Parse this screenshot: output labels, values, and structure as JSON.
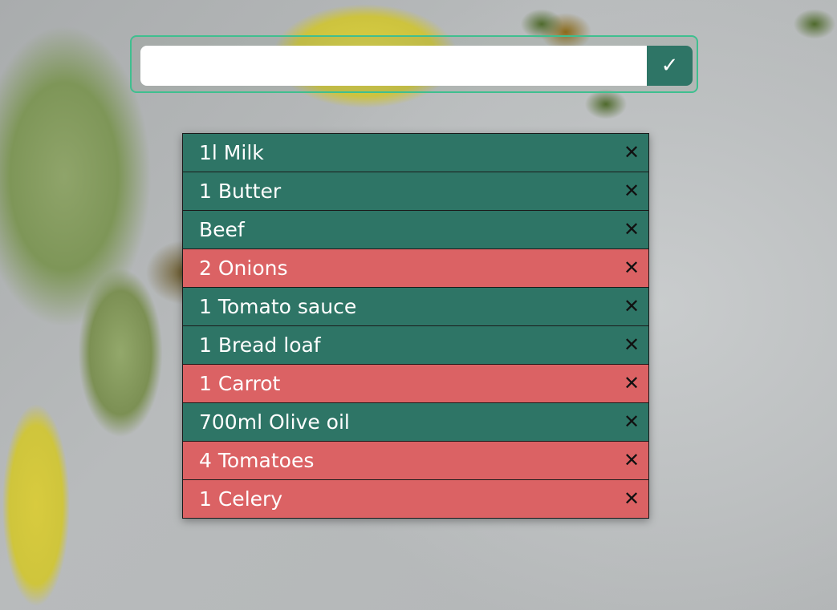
{
  "form": {
    "input_value": "",
    "input_placeholder": "",
    "submit_icon": "✓"
  },
  "colors": {
    "green": "#2e7566",
    "red": "#db6264",
    "accent_border": "#3fbf8f"
  },
  "items": [
    {
      "label": "1l Milk",
      "status": "green",
      "remove_icon": "✕"
    },
    {
      "label": "1 Butter",
      "status": "green",
      "remove_icon": "✕"
    },
    {
      "label": "Beef",
      "status": "green",
      "remove_icon": "✕"
    },
    {
      "label": "2 Onions",
      "status": "red",
      "remove_icon": "✕"
    },
    {
      "label": "1 Tomato sauce",
      "status": "green",
      "remove_icon": "✕"
    },
    {
      "label": "1 Bread loaf",
      "status": "green",
      "remove_icon": "✕"
    },
    {
      "label": "1 Carrot",
      "status": "red",
      "remove_icon": "✕"
    },
    {
      "label": "700ml Olive oil",
      "status": "green",
      "remove_icon": "✕"
    },
    {
      "label": "4 Tomatoes",
      "status": "red",
      "remove_icon": "✕"
    },
    {
      "label": "1 Celery",
      "status": "red",
      "remove_icon": "✕"
    }
  ]
}
